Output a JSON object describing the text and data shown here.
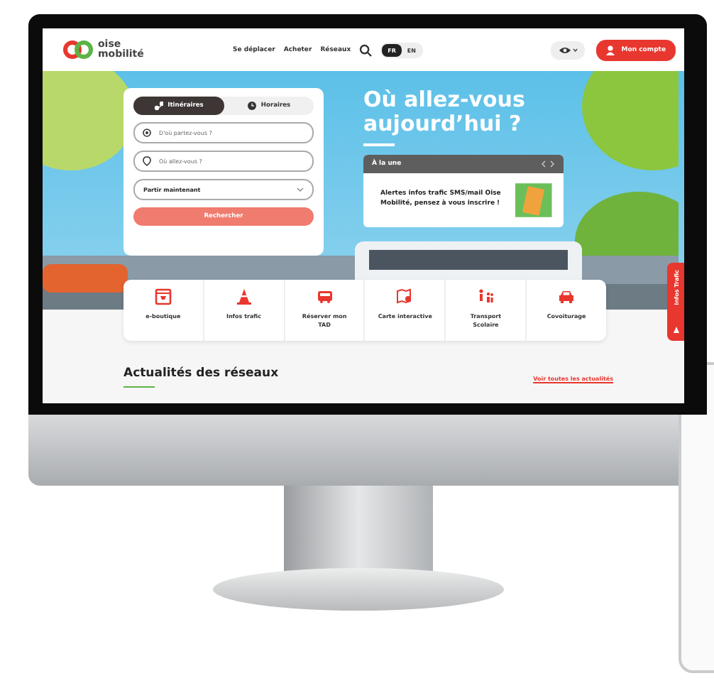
{
  "header": {
    "logo": {
      "line1": "oise",
      "line2": "mobilité"
    },
    "nav": [
      "Se déplacer",
      "Acheter",
      "Réseaux"
    ],
    "languages": [
      {
        "label": "FR",
        "selected": true
      },
      {
        "label": "EN",
        "selected": false
      }
    ],
    "account_button": "Mon compte"
  },
  "search_card": {
    "tabs": [
      {
        "label": "Itinéraires",
        "selected": true
      },
      {
        "label": "Horaires",
        "selected": false
      }
    ],
    "from": {
      "placeholder": "D'où partez-vous ?"
    },
    "to": {
      "placeholder": "Où allez-vous ?"
    },
    "when": {
      "value": "Partir maintenant"
    },
    "submit": "Rechercher"
  },
  "hero": {
    "heading": "Où allez-vous aujourd’hui ?"
  },
  "featured": {
    "title": "À la une",
    "text": "Alertes infos trafic SMS/mail Oise Mobilité, pensez à vous inscrire !"
  },
  "shortcuts": [
    {
      "kind": "shop",
      "label": "e-boutique"
    },
    {
      "kind": "cone",
      "label": "Infos trafic"
    },
    {
      "kind": "bus",
      "label": "Réserver mon TAD"
    },
    {
      "kind": "map",
      "label": "Carte interactive"
    },
    {
      "kind": "school",
      "label": "Transport Scolaire"
    },
    {
      "kind": "car",
      "label": "Covoiturage"
    }
  ],
  "side_tab": "Infos Trafic",
  "news": {
    "title": "Actualités des réseaux",
    "link": "Voir toutes les actualités"
  }
}
